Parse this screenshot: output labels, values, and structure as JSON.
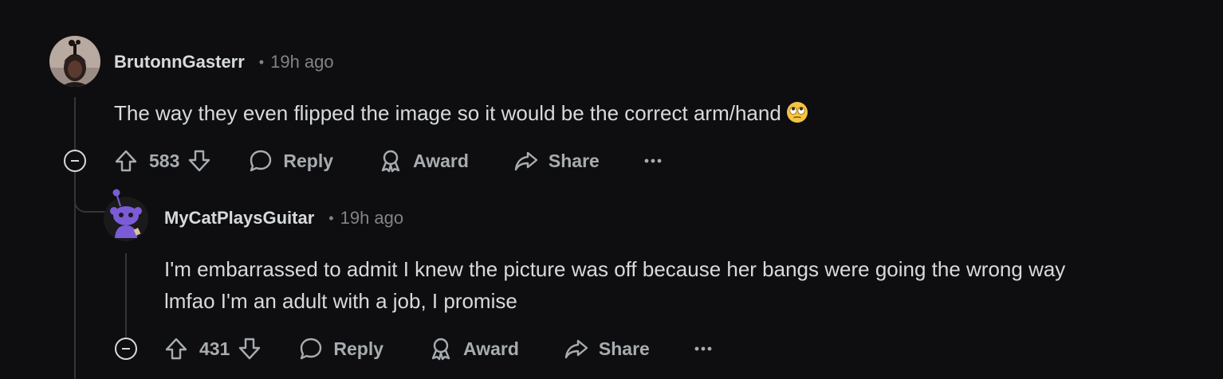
{
  "comments": [
    {
      "username": "BrutonnGasterr",
      "separator": "•",
      "timestamp": "19h ago",
      "body": "The way they even flipped the image so it would be the correct arm/hand",
      "votes": "583",
      "actions": {
        "reply": "Reply",
        "award": "Award",
        "share": "Share",
        "more": "•••"
      },
      "avatar_icon": "user-photo-avatar",
      "emoji_icon": "eye-roll-emoji"
    },
    {
      "username": "MyCatPlaysGuitar",
      "separator": "•",
      "timestamp": "19h ago",
      "body_lines": [
        "I'm embarrassed to admit I knew the picture was off because her bangs were going the wrong way",
        "lmfao I'm an adult with a job, I promise"
      ],
      "votes": "431",
      "actions": {
        "reply": "Reply",
        "award": "Award",
        "share": "Share",
        "more": "•••"
      },
      "avatar_icon": "snoo-avatar"
    }
  ],
  "colors": {
    "background": "#0e0e10",
    "text": "#d7dadc",
    "muted": "#818384",
    "action": "#a7acb0",
    "thread_line": "#343536",
    "snoo_purple": "#7b5cd6"
  }
}
